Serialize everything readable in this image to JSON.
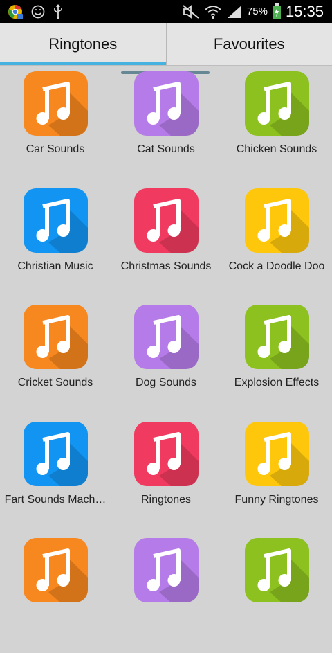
{
  "status_bar": {
    "battery_text": "75%",
    "time": "15:35",
    "icons": [
      "chrome-icon",
      "smiley-icon",
      "usb-icon",
      "mute-icon",
      "wifi-icon",
      "signal-icon",
      "battery-icon"
    ]
  },
  "tabs": [
    {
      "label": "Ringtones",
      "active": true
    },
    {
      "label": "Favourites",
      "active": false
    }
  ],
  "colors": {
    "orange": "#f7881f",
    "purple": "#b57be8",
    "green": "#8cc11f",
    "blue": "#1294f2",
    "red": "#f03a5f",
    "yellow": "#fec70c",
    "tab_indicator": "#46b2e0"
  },
  "items": [
    {
      "label": "Car Sounds",
      "color": "orange"
    },
    {
      "label": "Cat Sounds",
      "color": "purple"
    },
    {
      "label": "Chicken Sounds",
      "color": "green"
    },
    {
      "label": "Christian Music",
      "color": "blue"
    },
    {
      "label": "Christmas Sounds",
      "color": "red"
    },
    {
      "label": "Cock a Doodle Doo",
      "color": "yellow"
    },
    {
      "label": "Cricket Sounds",
      "color": "orange"
    },
    {
      "label": "Dog Sounds",
      "color": "purple"
    },
    {
      "label": "Explosion Effects",
      "color": "green"
    },
    {
      "label": "Fart Sounds Mach…",
      "color": "blue"
    },
    {
      "label": "Ringtones",
      "color": "red"
    },
    {
      "label": "Funny Ringtones",
      "color": "yellow"
    },
    {
      "label": "",
      "color": "orange"
    },
    {
      "label": "",
      "color": "purple"
    },
    {
      "label": "",
      "color": "green"
    }
  ]
}
